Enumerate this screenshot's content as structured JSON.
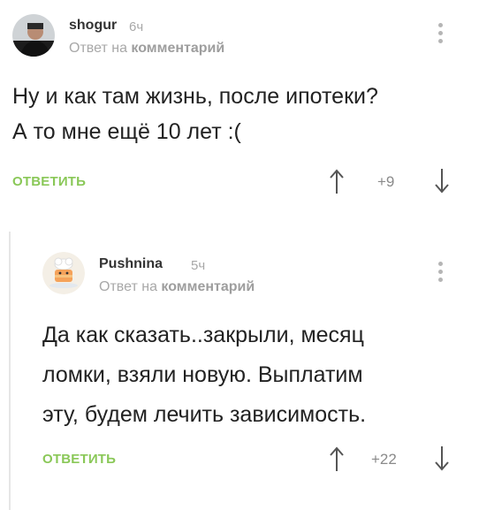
{
  "comments": [
    {
      "username": "shogur",
      "time": "6ч",
      "reply_prefix": "Ответ на",
      "reply_link": "комментарий",
      "text_lines": [
        "Ну и как там жизнь, после ипотеки?",
        "А то мне ещё 10 лет :("
      ],
      "reply_label": "ОТВЕТИТЬ",
      "rating": "+9",
      "avatar_icon": "user-photo-avatar"
    },
    {
      "username": "Pushnina",
      "time": "5ч",
      "reply_prefix": "Ответ на",
      "reply_link": "комментарий",
      "text_lines": [
        "Да как сказать..закрыли, месяц",
        "ломки, взяли новую. Выплатим",
        "эту, будем лечить зависимость."
      ],
      "reply_label": "ОТВЕТИТЬ",
      "rating": "+22",
      "avatar_icon": "chef-cake-avatar"
    }
  ],
  "colors": {
    "accent": "#8ac858",
    "muted": "#a8a8a8",
    "text": "#222222"
  }
}
